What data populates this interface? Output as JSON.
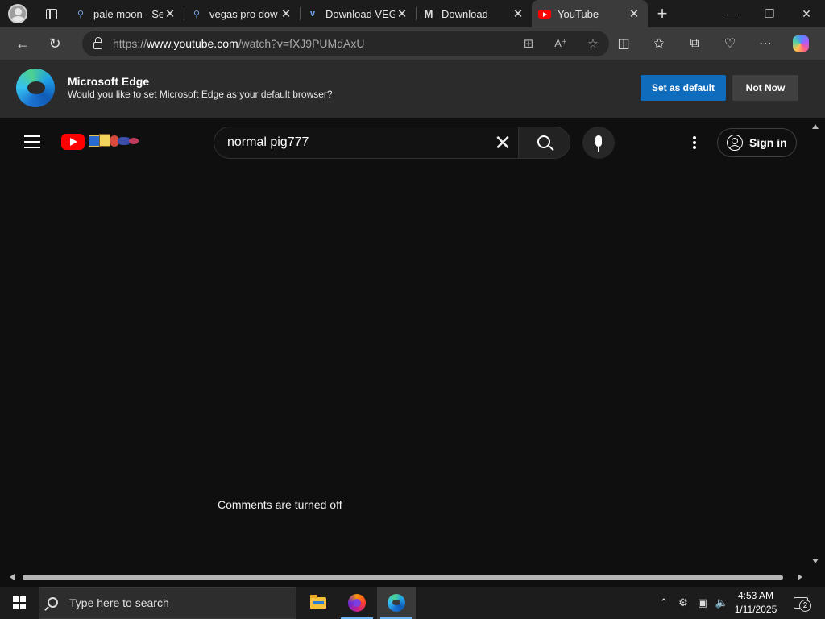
{
  "browser": {
    "tabs": [
      {
        "title": "pale moon - Se",
        "favicon": "search-icon"
      },
      {
        "title": "vegas pro dow",
        "favicon": "search-icon"
      },
      {
        "title": "Download VEG",
        "favicon": "v-letter-icon"
      },
      {
        "title": "Download",
        "favicon": "m-letter-icon"
      },
      {
        "title": "YouTube",
        "favicon": "youtube-icon",
        "active": true
      }
    ],
    "url": {
      "scheme": "https://",
      "host": "www.youtube.com",
      "path": "/watch?v=fXJ9PUMdAxU"
    }
  },
  "banner": {
    "title": "Microsoft Edge",
    "subtitle": "Would you like to set Microsoft Edge as your default browser?",
    "primary_label": "Set as default",
    "secondary_label": "Not Now"
  },
  "youtube": {
    "search_value": "normal pig777",
    "signin_label": "Sign in",
    "comments_status": "Comments are turned off"
  },
  "taskbar": {
    "search_placeholder": "Type here to search",
    "apps": [
      "file-explorer-icon",
      "firefox-icon",
      "edge-icon"
    ],
    "time": "4:53 AM",
    "date": "1/11/2025",
    "notification_count": "2"
  },
  "colors": {
    "accent": "#0f6cbd",
    "youtube_red": "#ff0000",
    "page_bg": "#0f0f0f"
  }
}
